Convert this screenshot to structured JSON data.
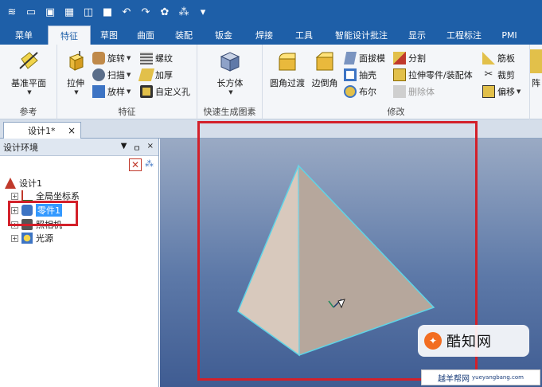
{
  "quick_access": {
    "icons": [
      "app-menu-icon",
      "new-file-icon",
      "pdf-icon",
      "open-file-icon",
      "folder-icon",
      "save-icon",
      "undo-icon",
      "redo-icon",
      "options-icon",
      "filter-icon",
      "customize-icon"
    ]
  },
  "tabs": [
    "菜单",
    "特征",
    "草图",
    "曲面",
    "装配",
    "钣金",
    "焊接",
    "工具",
    "智能设计批注",
    "显示",
    "工程标注",
    "PMI"
  ],
  "active_tab": "特征",
  "ribbon": {
    "groups": {
      "reference": {
        "label": "参考",
        "datum_plane": "基准平面"
      },
      "feature": {
        "label": "特征",
        "extrude": "拉伸",
        "revolve": "旋转",
        "sweep": "扫描",
        "loft": "放样",
        "thread": "螺纹",
        "thicken": "加厚",
        "custom_hole": "自定义孔"
      },
      "quick": {
        "label": "快速生成图素",
        "box": "长方体"
      },
      "modify": {
        "label": "修改",
        "fillet": "圆角过渡",
        "chamfer": "边倒角",
        "draft": "面拔模",
        "shell": "抽壳",
        "boolean": "布尔",
        "split": "分割",
        "extrude_to_part": "拉伸零件/装配体",
        "delete_body": "删除体",
        "rib": "筋板",
        "trim": "裁剪",
        "offset": "偏移"
      },
      "array_partial": "阵"
    }
  },
  "document_tab": {
    "label": "设计1*",
    "close": "×"
  },
  "panel": {
    "title": "设计环境",
    "controls": [
      "▼",
      "ㅁ",
      "×"
    ],
    "tree": {
      "root": "设计1",
      "coordinate_system": "全局坐标系",
      "part": "零件1",
      "camera": "照相机",
      "light": "光源"
    }
  },
  "watermark": {
    "brand": "酷知网",
    "site": "yueyangbang.com",
    "site_cn": "越羊帮网"
  },
  "colors": {
    "ribbon_blue": "#1e5fa8",
    "highlight_red": "#d3202a",
    "selection_blue": "#3399ff",
    "pyramid_face_left": "#d8c9bd",
    "pyramid_face_right": "#b6a79c",
    "pyramid_edge": "#5fd4e6"
  }
}
